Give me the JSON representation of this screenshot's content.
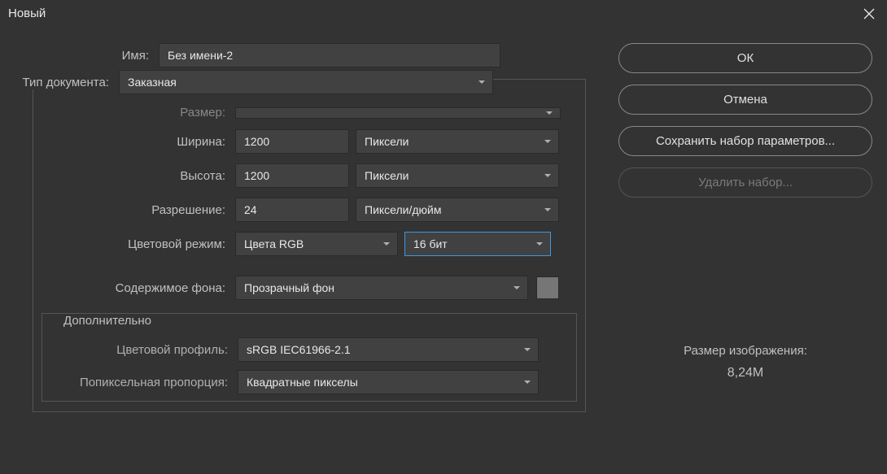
{
  "window": {
    "title": "Новый"
  },
  "form": {
    "name_label": "Имя:",
    "name_value": "Без имени-2",
    "doctype_label": "Тип документа:",
    "doctype_value": "Заказная",
    "size_label": "Размер:",
    "size_value": "",
    "width_label": "Ширина:",
    "width_value": "1200",
    "width_units": "Пиксели",
    "height_label": "Высота:",
    "height_value": "1200",
    "height_units": "Пиксели",
    "resolution_label": "Разрешение:",
    "resolution_value": "24",
    "resolution_units": "Пиксели/дюйм",
    "colormode_label": "Цветовой режим:",
    "colormode_value": "Цвета RGB",
    "bitdepth_value": "16 бит",
    "bgcontent_label": "Содержимое фона:",
    "bgcontent_value": "Прозрачный фон"
  },
  "advanced": {
    "title": "Дополнительно",
    "profile_label": "Цветовой профиль:",
    "profile_value": "sRGB IEC61966-2.1",
    "pixelaspect_label": "Попиксельная пропорция:",
    "pixelaspect_value": "Квадратные пикселы"
  },
  "buttons": {
    "ok": "ОК",
    "cancel": "Отмена",
    "save_preset": "Сохранить набор параметров...",
    "delete_preset": "Удалить набор..."
  },
  "sizeinfo": {
    "label": "Размер изображения:",
    "value": "8,24M"
  }
}
